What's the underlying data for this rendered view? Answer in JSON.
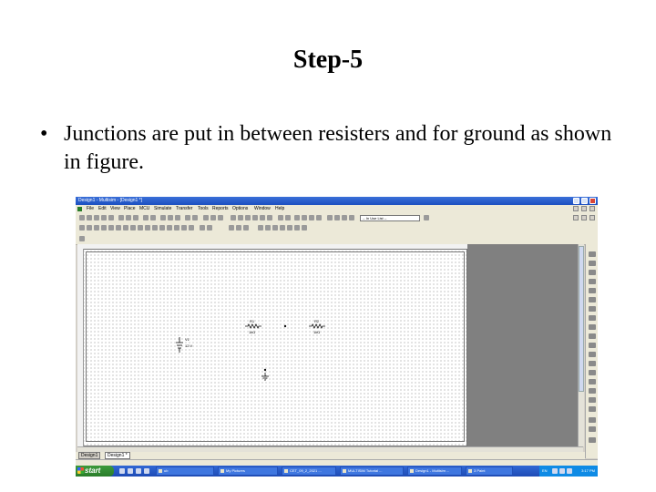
{
  "slide": {
    "title": "Step-5",
    "bullet_marker": "•",
    "bullet_text": "Junctions are put in between resisters and for ground as shown in figure."
  },
  "window": {
    "title": "Design1 - Multisim - [Design1 *]"
  },
  "menu": {
    "items": [
      "File",
      "Edit",
      "View",
      "Place",
      "MCU",
      "Simulate",
      "Transfer",
      "Tools",
      "Reports",
      "Options",
      "Window",
      "Help"
    ]
  },
  "toolbar": {
    "in_use_list": "-- In Use List --"
  },
  "schematic": {
    "components": [
      {
        "ref": "R1",
        "value": "1kΩ"
      },
      {
        "ref": "R2",
        "value": "1kΩ"
      },
      {
        "ref": "V1",
        "value": "12 V"
      }
    ]
  },
  "tabs": [
    {
      "label": "Design1"
    },
    {
      "label": "Design1 *"
    }
  ],
  "taskbar": {
    "start_label": "start",
    "tasks": [
      "ub",
      "My Pictures",
      "CET_09_2_2021 ...",
      "MULTISIM Tutorial ...",
      "Design1 - Multisim ...",
      "3 Paint"
    ],
    "language": "EN",
    "clock": "3:17 PM"
  },
  "colors": {
    "titlebar": "#1c4fc0",
    "taskbar": "#1e4bb5",
    "start_button": "#2a7d2a",
    "workspace_outside": "#808080"
  }
}
